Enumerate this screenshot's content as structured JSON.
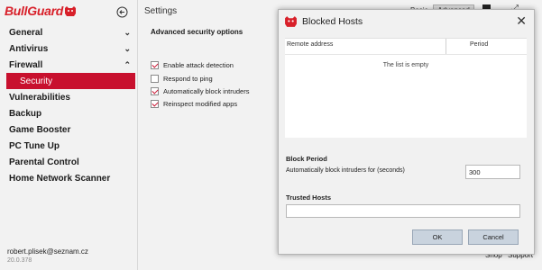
{
  "app": {
    "brand": "BullGuard",
    "settings_title": "Settings",
    "mode_basic": "Basic",
    "mode_advanced": "Advanced",
    "accent_color": "#c8102e"
  },
  "sidebar": {
    "items": [
      {
        "label": "General",
        "chevron": "chevron-down-icon"
      },
      {
        "label": "Antivirus",
        "chevron": "chevron-down-icon"
      },
      {
        "label": "Firewall",
        "chevron": "chevron-up-icon"
      }
    ],
    "selected_sub": "Security",
    "items_after": [
      {
        "label": "Vulnerabilities"
      },
      {
        "label": "Backup"
      },
      {
        "label": "Game Booster"
      },
      {
        "label": "PC Tune Up"
      },
      {
        "label": "Parental Control"
      },
      {
        "label": "Home Network Scanner"
      }
    ],
    "user_email": "robert.plisek@seznam.cz",
    "version": "20.0.378"
  },
  "panel": {
    "heading": "Advanced security options",
    "options": [
      {
        "label": "Enable attack detection",
        "checked": true
      },
      {
        "label": "Respond to ping",
        "checked": false
      },
      {
        "label": "Automatically block intruders",
        "checked": true
      },
      {
        "label": "Reinspect modified apps",
        "checked": true
      }
    ]
  },
  "footer": {
    "shop": "Shop",
    "support": "Support"
  },
  "dialog": {
    "title": "Blocked Hosts",
    "columns": [
      "Remote address",
      "Period"
    ],
    "empty_message": "The list is empty",
    "block_period_heading": "Block Period",
    "block_period_label": "Automatically block intruders for (seconds)",
    "block_period_value": "300",
    "trusted_hosts_heading": "Trusted Hosts",
    "trusted_hosts_value": "",
    "ok_label": "OK",
    "cancel_label": "Cancel"
  }
}
